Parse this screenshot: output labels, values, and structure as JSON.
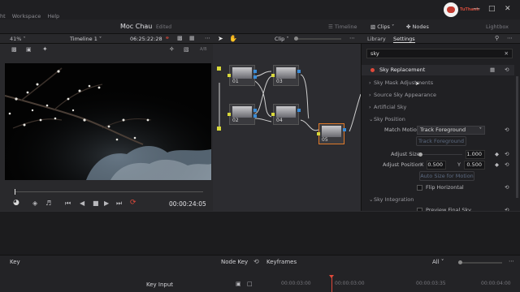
{
  "menu": [
    "ht",
    "Workspace",
    "Help"
  ],
  "project_title": "Moc Chau",
  "project_status": "Edited",
  "top_right": {
    "timeline_label": "Timeline",
    "clips_label": "Clips",
    "nodes_label": "Nodes",
    "lightbox_label": "Lightbox",
    "watermark_text": "TuThanh"
  },
  "viewer_bar": {
    "zoom": "41%",
    "timeline_name": "Timeline 1",
    "timecode": "06:25:22:28",
    "clip_label": "Clip"
  },
  "transport": {
    "timecode": "00:00:24:05"
  },
  "nodes": [
    {
      "label": "01"
    },
    {
      "label": "03"
    },
    {
      "label": "02"
    },
    {
      "label": "04"
    },
    {
      "label": "05"
    }
  ],
  "panel": {
    "tabs": [
      "Library",
      "Settings"
    ],
    "search_value": "sky",
    "effect_name": "Sky Replacement",
    "sections": {
      "mask_adjustments": "Sky Mask Adjustments",
      "source_sky_appearance": "Source Sky Appearance",
      "artificial_sky": "Artificial Sky",
      "sky_position": "Sky Position",
      "sky_integration": "Sky Integration"
    },
    "match_motion_label": "Match Motion",
    "match_motion_value": "Track Foreground",
    "track_foreground_button": "Track Foreground",
    "adjust_size_label": "Adjust Size",
    "adjust_size_value": "1.000",
    "adjust_size_fraction": 0.0,
    "adjust_position_label": "Adjust Position",
    "x_label": "X",
    "x_value": "0.500",
    "y_label": "Y",
    "y_value": "0.500",
    "auto_size_button": "Auto Size for Motion",
    "flip_horizontal_label": "Flip Horizontal",
    "preview_final_sky_label": "Preview Final Sky"
  },
  "bottom": {
    "key_label": "Key",
    "node_key_label": "Node Key",
    "keyframes_label": "Keyframes",
    "filter_label": "All",
    "key_input_label": "Key Input",
    "ruler": [
      "00:00:03:00",
      "00:00:03:00",
      "00:00:03:35",
      "00:00:04:00"
    ]
  },
  "colors": {
    "accent_red": "#e0493a",
    "track_orange": "#e07a2a",
    "node_input": "#d8d83a",
    "node_output": "#3a8cd8"
  }
}
